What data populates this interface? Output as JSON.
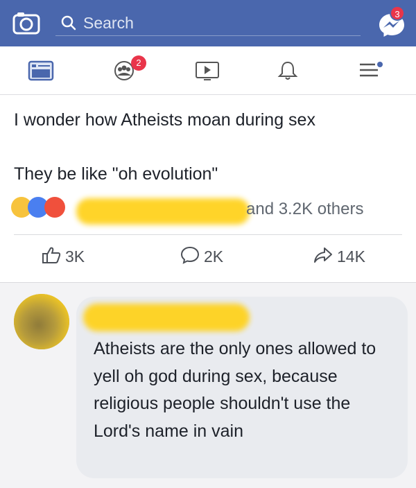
{
  "header": {
    "search_placeholder": "Search",
    "messenger_badge": "3",
    "colors": {
      "bar": "#4a67ad",
      "badge": "#e9354a"
    }
  },
  "nav": {
    "items": [
      {
        "icon": "news-feed-icon"
      },
      {
        "icon": "groups-icon",
        "badge": "2"
      },
      {
        "icon": "watch-video-icon"
      },
      {
        "icon": "notifications-bell-icon"
      },
      {
        "icon": "menu-icon"
      }
    ]
  },
  "post": {
    "line1": "I wonder how Atheists moan during sex",
    "line2": "They be like \"oh evolution\"",
    "reactions_others": "and 3.2K others",
    "actions": {
      "like_count": "3K",
      "comment_count": "2K",
      "share_count": "14K"
    }
  },
  "comment": {
    "text": "Atheists are the only ones allowed to yell oh god during sex, because religious people shouldn't use the Lord's name in vain"
  },
  "redaction_color": "#ffd21e"
}
